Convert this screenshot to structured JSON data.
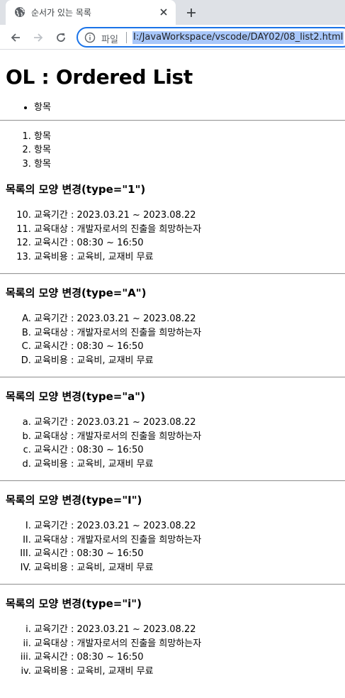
{
  "browser": {
    "tab_title": "순서가 있는 목록",
    "scheme_label": "파일",
    "url": "I:/JavaWorkspace/vscode/DAY02/08_list2.html"
  },
  "page": {
    "heading": "OL : Ordered List",
    "unordered_list": [
      "항목"
    ],
    "ordered_list": [
      "항목",
      "항목",
      "항목"
    ],
    "sections": [
      {
        "heading": "목록의 모양 변경(type=\"1\")",
        "type": "1",
        "start": 10,
        "items": [
          "교육기간 : 2023.03.21 ~ 2023.08.22",
          "교육대상 : 개발자로서의 진출을 희망하는자",
          "교육시간 : 08:30 ~ 16:50",
          "교육비용 : 교육비, 교재비 무료"
        ]
      },
      {
        "heading": "목록의 모양 변경(type=\"A\")",
        "type": "A",
        "start": 1,
        "items": [
          "교육기간 : 2023.03.21 ~ 2023.08.22",
          "교육대상 : 개발자로서의 진출을 희망하는자",
          "교육시간 : 08:30 ~ 16:50",
          "교육비용 : 교육비, 교재비 무료"
        ]
      },
      {
        "heading": "목록의 모양 변경(type=\"a\")",
        "type": "a",
        "start": 1,
        "items": [
          "교육기간 : 2023.03.21 ~ 2023.08.22",
          "교육대상 : 개발자로서의 진출을 희망하는자",
          "교육시간 : 08:30 ~ 16:50",
          "교육비용 : 교육비, 교재비 무료"
        ]
      },
      {
        "heading": "목록의 모양 변경(type=\"I\")",
        "type": "I",
        "start": 1,
        "items": [
          "교육기간 : 2023.03.21 ~ 2023.08.22",
          "교육대상 : 개발자로서의 진출을 희망하는자",
          "교육시간 : 08:30 ~ 16:50",
          "교육비용 : 교육비, 교재비 무료"
        ]
      },
      {
        "heading": "목록의 모양 변경(type=\"i\")",
        "type": "i",
        "start": 1,
        "items": [
          "교육기간 : 2023.03.21 ~ 2023.08.22",
          "교육대상 : 개발자로서의 진출을 희망하는자",
          "교육시간 : 08:30 ~ 16:50",
          "교육비용 : 교육비, 교재비 무료"
        ]
      }
    ]
  }
}
